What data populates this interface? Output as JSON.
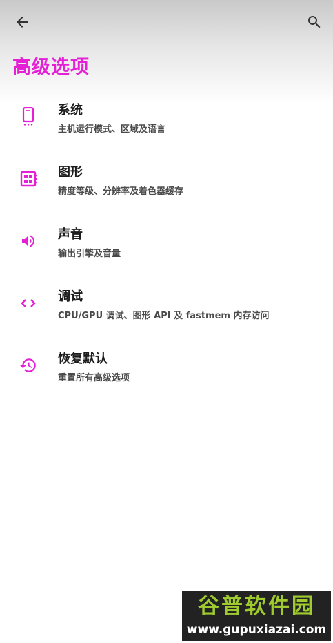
{
  "header": {
    "title": "高级选项",
    "back_icon": "arrow-back-icon",
    "search_icon": "search-icon"
  },
  "accent_color": "#e51fd6",
  "items": [
    {
      "icon": "phone-icon",
      "title": "系统",
      "subtitle": "主机运行模式、区域及语言"
    },
    {
      "icon": "chip-icon",
      "title": "图形",
      "subtitle": "精度等级、分辨率及着色器缓存"
    },
    {
      "icon": "volume-icon",
      "title": "声音",
      "subtitle": "输出引擎及音量"
    },
    {
      "icon": "code-icon",
      "title": "调试",
      "subtitle": "CPU/GPU 调试、图形 API 及 fastmem 内存访问"
    },
    {
      "icon": "history-icon",
      "title": "恢复默认",
      "subtitle": "重置所有高级选项"
    }
  ],
  "watermark": {
    "logo_text": "谷普软件园",
    "url": "www.gupuxiazai.com"
  }
}
